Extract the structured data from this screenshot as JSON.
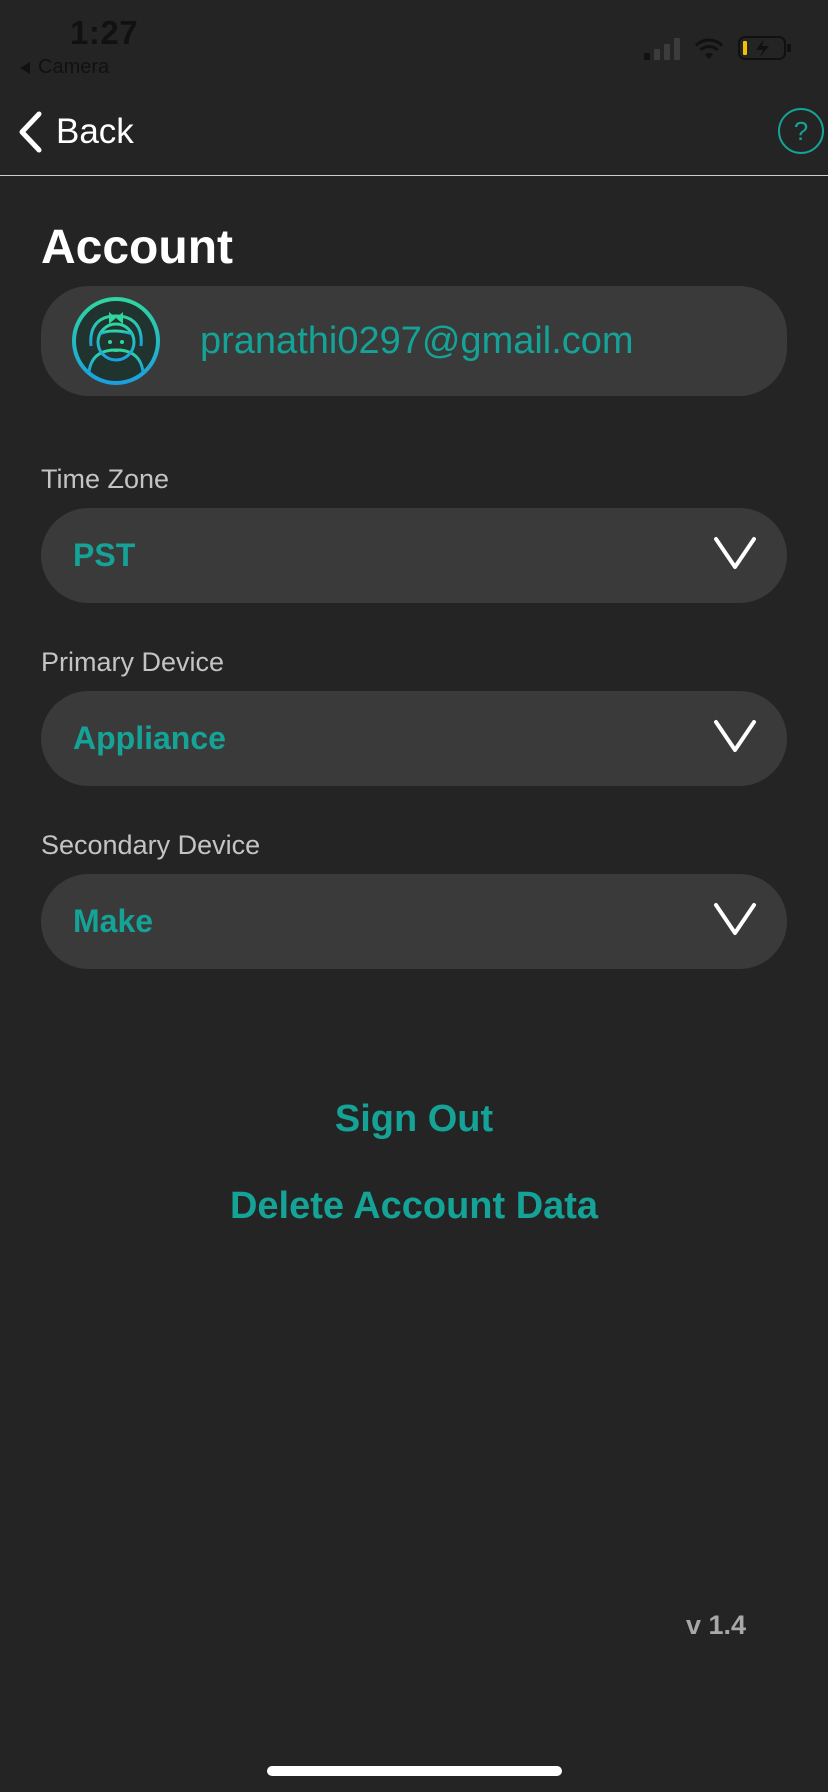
{
  "status_bar": {
    "time": "1:27",
    "back_app": "Camera"
  },
  "nav": {
    "back_label": "Back",
    "help_label": "?"
  },
  "page": {
    "title": "Account"
  },
  "account": {
    "email": "pranathi0297@gmail.com"
  },
  "fields": {
    "time_zone": {
      "label": "Time Zone",
      "value": "PST"
    },
    "primary_device": {
      "label": "Primary Device",
      "value": "Appliance"
    },
    "secondary_device": {
      "label": "Secondary Device",
      "value": "Make"
    }
  },
  "actions": {
    "sign_out": "Sign Out",
    "delete_account": "Delete Account Data"
  },
  "footer": {
    "version": "v 1.4"
  },
  "colors": {
    "background": "#242424",
    "accent": "#14a396",
    "pill": "#3a3a3a",
    "battery_level": "#f2c200"
  },
  "icons": {
    "back": "chevron-left-icon",
    "help": "question-circle-icon",
    "avatar": "girl-avatar-icon",
    "dropdown": "chevron-down-icon"
  }
}
